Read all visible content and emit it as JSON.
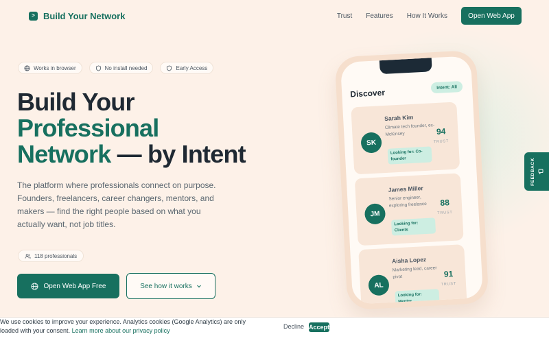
{
  "header": {
    "brand": "Build Your Network",
    "nav": [
      "Trust",
      "Features",
      "How It Works"
    ],
    "cta": "Open Web App"
  },
  "badges": [
    {
      "label": "Works in browser",
      "icon": "globe-icon"
    },
    {
      "label": "No install needed",
      "icon": "shield-icon"
    },
    {
      "label": "Early Access",
      "icon": "shield-icon"
    }
  ],
  "hero": {
    "line1": "Build Your",
    "line2": "Professional",
    "line3_accent": "Network",
    "line3_rest": " — by Intent",
    "description": "The platform where professionals connect on purpose. Founders, freelancers, career changers, mentors, and makers — find the right people based on what you actually want, not job titles.",
    "count": "118 professionals",
    "primary_cta": "Open Web App Free",
    "secondary_cta": "See how it works"
  },
  "phone": {
    "title": "Discover",
    "intent_filter": "Intent: All",
    "profiles": [
      {
        "initials": "SK",
        "name": "Sarah Kim",
        "role": "Climate tech founder, ex-McKinsey",
        "looking_for": "Looking for: Co-founder",
        "score": "94",
        "trust": "TRUST"
      },
      {
        "initials": "JM",
        "name": "James Miller",
        "role": "Senior engineer, exploring freelance",
        "looking_for": "Looking for: Clients",
        "score": "88",
        "trust": "TRUST"
      },
      {
        "initials": "AL",
        "name": "Aisha Lopez",
        "role": "Marketing lead, career pivot",
        "looking_for": "Looking for: Mentor",
        "score": "91",
        "trust": "TRUST"
      }
    ]
  },
  "feedback": {
    "label": "FEEDBACK"
  },
  "cookie": {
    "text": "We use cookies to improve your experience. Analytics cookies (Google Analytics) are only loaded with your consent.",
    "link": "Learn more about our privacy policy",
    "decline": "Decline",
    "accept": "Accept"
  },
  "colors": {
    "brand": "#17705f",
    "background": "#fdf1e8",
    "accent_soft": "#cdeee2"
  }
}
